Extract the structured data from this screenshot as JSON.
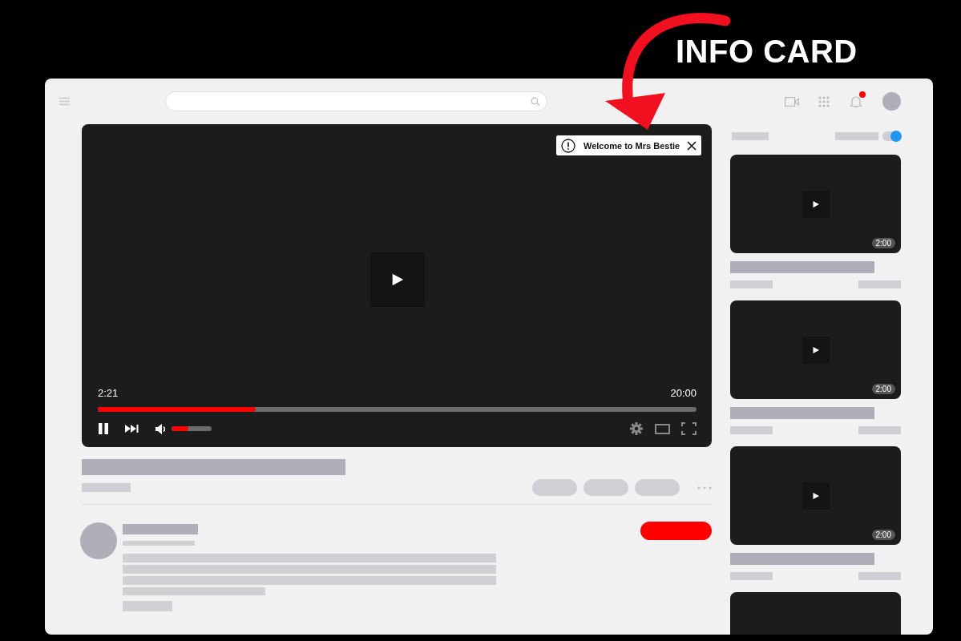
{
  "annotation": {
    "label": "INFO CARD"
  },
  "topbar": {
    "notifications": {
      "unread": true
    }
  },
  "player": {
    "info_card": {
      "text": "Welcome to Mrs Bestie"
    },
    "playing": true,
    "current_time": "2:21",
    "duration": "20:00",
    "progress": {
      "level": 0.264
    },
    "volume": {
      "level": 0.42
    }
  },
  "channel": {
    "subscribed": false
  },
  "sidebar": {
    "autoplay": {
      "on": true
    },
    "videos": [
      {
        "kind": "full",
        "duration": "2:00"
      },
      {
        "kind": "full",
        "duration": "2:00"
      },
      {
        "kind": "full",
        "duration": "2:00"
      },
      {
        "kind": "partial"
      }
    ]
  }
}
